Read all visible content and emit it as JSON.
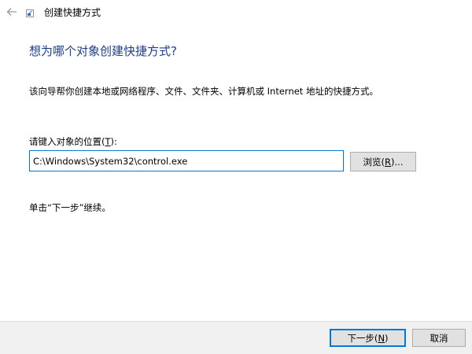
{
  "window": {
    "title": "创建快捷方式",
    "back_icon": "arrow-left-icon",
    "app_icon": "shortcut-app-icon"
  },
  "main": {
    "heading": "想为哪个对象创建快捷方式?",
    "description": "该向导帮你创建本地或网络程序、文件、文件夹、计算机或 Internet 地址的快捷方式。",
    "location_label_prefix": "请键入对象的位置(",
    "location_label_key": "T",
    "location_label_suffix": "):",
    "location_value": "C:\\Windows\\System32\\control.exe",
    "browse_label_prefix": "浏览(",
    "browse_label_key": "R",
    "browse_label_suffix": ")...",
    "continue_hint": "单击“下一步”继续。"
  },
  "footer": {
    "next_label_prefix": "下一步(",
    "next_label_key": "N",
    "next_label_suffix": ")",
    "cancel_label": "取消"
  },
  "colors": {
    "heading": "#1a3e8c",
    "accent": "#0078d7",
    "footer_bg": "#f0f0f0",
    "button_bg": "#e1e1e1"
  }
}
